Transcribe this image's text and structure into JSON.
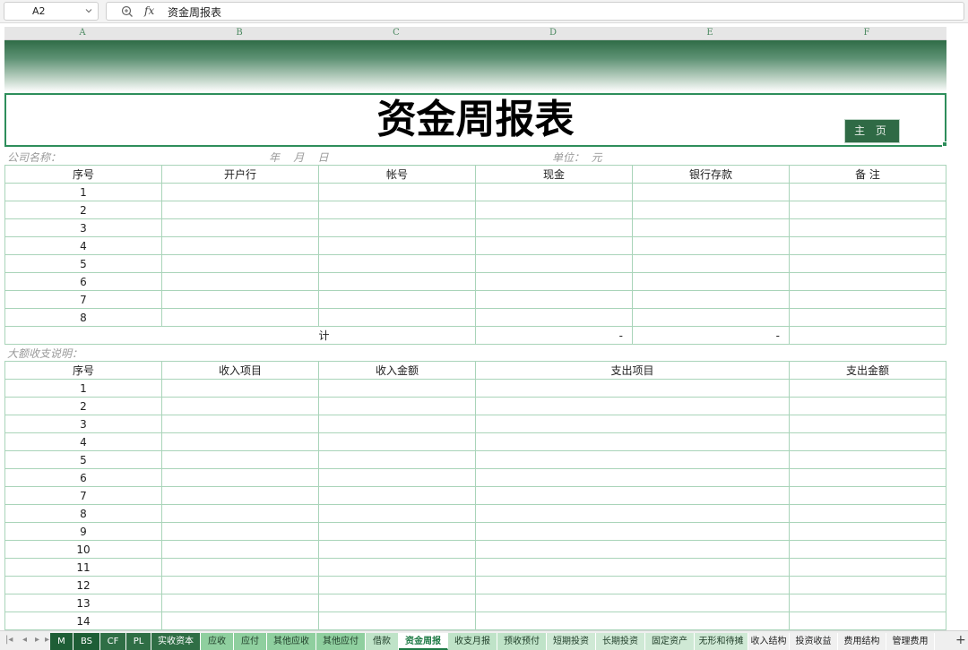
{
  "formula_bar": {
    "cell_ref": "A2",
    "fx_label": "fx",
    "content": "资金周报表"
  },
  "columns": [
    "A",
    "B",
    "C",
    "D",
    "E",
    "F"
  ],
  "title": "资金周报表",
  "home_button": "主 页",
  "info": {
    "company": "公司名称：",
    "date": "年    月    日",
    "unit": "单位：  元"
  },
  "table1": {
    "headers": [
      "序号",
      "开户行",
      "帐号",
      "现金",
      "银行存款",
      "备    注"
    ],
    "rows": [
      "1",
      "2",
      "3",
      "4",
      "5",
      "6",
      "7",
      "8"
    ],
    "total_label": "合计",
    "total_cash": "-",
    "total_bank": "-"
  },
  "section2_label": "大额收支说明：",
  "table2": {
    "headers": [
      "序号",
      "收入项目",
      "收入金额",
      "支出项目",
      "支出金额"
    ],
    "rows": [
      "1",
      "2",
      "3",
      "4",
      "5",
      "6",
      "7",
      "8",
      "9",
      "10",
      "11",
      "12",
      "13",
      "14"
    ]
  },
  "sheet_tabs": {
    "items": [
      {
        "label": "M",
        "bg": "#1e5e36",
        "fg": "#ffffff"
      },
      {
        "label": "BS",
        "bg": "#1e5e36",
        "fg": "#ffffff"
      },
      {
        "label": "CF",
        "bg": "#2f6e45",
        "fg": "#ffffff"
      },
      {
        "label": "PL",
        "bg": "#2f6e45",
        "fg": "#ffffff"
      },
      {
        "label": "实收资本",
        "bg": "#2f6e45",
        "fg": "#ffffff"
      },
      {
        "label": "应收",
        "bg": "#8fcf9f",
        "fg": "#1f3d28"
      },
      {
        "label": "应付",
        "bg": "#8fcf9f",
        "fg": "#1f3d28"
      },
      {
        "label": "其他应收",
        "bg": "#8fcf9f",
        "fg": "#1f3d28"
      },
      {
        "label": "其他应付",
        "bg": "#8fcf9f",
        "fg": "#1f3d28"
      },
      {
        "label": "借款",
        "bg": "#bfe3c8",
        "fg": "#1f3d28"
      },
      {
        "label": "资金周报",
        "bg": "#ffffff",
        "fg": "#1e7a45"
      },
      {
        "label": "收支月报",
        "bg": "#bfe3c8",
        "fg": "#1f3d28"
      },
      {
        "label": "预收预付",
        "bg": "#bfe3c8",
        "fg": "#1f3d28"
      },
      {
        "label": "短期投资",
        "bg": "#cfe9d5",
        "fg": "#1f3d28"
      },
      {
        "label": "长期投资",
        "bg": "#cfe9d5",
        "fg": "#1f3d28"
      },
      {
        "label": "固定资产",
        "bg": "#cfe9d5",
        "fg": "#1f3d28"
      },
      {
        "label": "无形和待摊",
        "bg": "#cfe9d5",
        "fg": "#1f3d28"
      },
      {
        "label": "收入结构",
        "bg": "#f0f0f0",
        "fg": "#222222"
      },
      {
        "label": "投资收益",
        "bg": "#f0f0f0",
        "fg": "#222222"
      },
      {
        "label": "费用结构",
        "bg": "#f0f0f0",
        "fg": "#222222"
      },
      {
        "label": "管理费用",
        "bg": "#f0f0f0",
        "fg": "#222222"
      }
    ],
    "add_label": "+"
  }
}
